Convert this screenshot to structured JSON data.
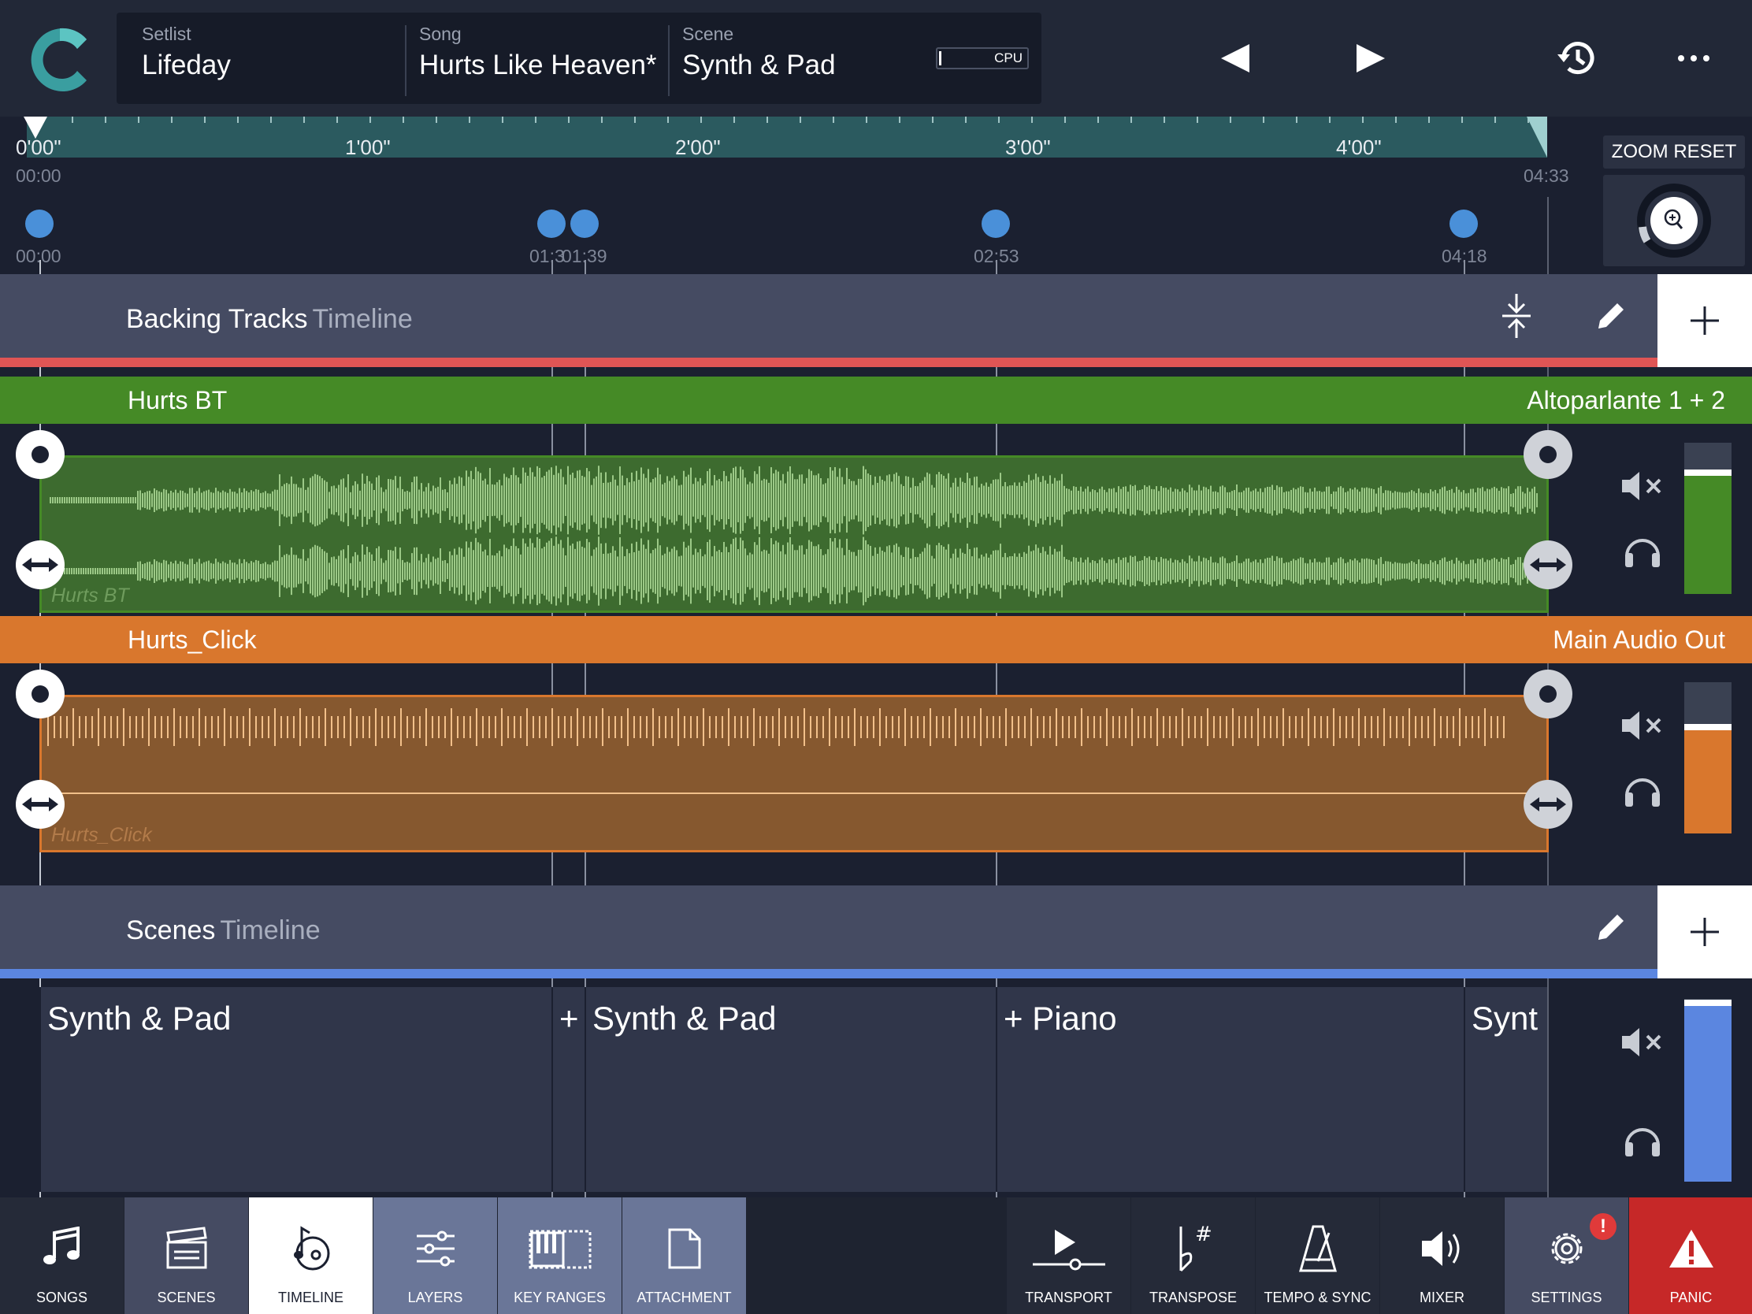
{
  "header": {
    "setlist_label": "Setlist",
    "setlist_value": "Lifeday",
    "song_label": "Song",
    "song_value": "Hurts Like Heaven*",
    "scene_label": "Scene",
    "scene_value": "Synth & Pad",
    "cpu_label": "CPU",
    "icons": [
      "app-logo",
      "previous-icon",
      "play-icon",
      "history-icon",
      "more-icon"
    ]
  },
  "ruler": {
    "time_labels": [
      "0'00\"",
      "1'00\"",
      "2'00\"",
      "3'00\"",
      "4'00\""
    ],
    "start_time": "00:00",
    "end_time": "04:33",
    "markers": [
      "00:00",
      "01:30",
      "01:39",
      "02:53",
      "04:18"
    ],
    "marker_labels": [
      "00:00",
      "01:3",
      "01:39",
      "02:53",
      "04:18"
    ],
    "zoom_reset_label": "ZOOM RESET"
  },
  "backing": {
    "title": "Backing Tracks",
    "subtitle": "Timeline",
    "accent": "#e05555",
    "tracks": [
      {
        "name": "Hurts BT",
        "output": "Altoparlante 1 + 2",
        "clip_label": "Hurts BT",
        "color": "#458a26",
        "meter_level": 0.78
      },
      {
        "name": "Hurts_Click",
        "output": "Main Audio Out",
        "clip_label": "Hurts_Click",
        "color": "#d9772d",
        "meter_level": 0.68
      }
    ]
  },
  "scenes": {
    "title": "Scenes",
    "subtitle": "Timeline",
    "accent": "#5b86e0",
    "blocks": [
      "Synth & Pad",
      "+",
      "Synth & Pad",
      "+ Piano",
      "Synt"
    ],
    "meter_level": 0.96
  },
  "bottom_nav": {
    "left": [
      "SONGS",
      "SCENES",
      "TIMELINE",
      "LAYERS",
      "KEY RANGES",
      "ATTACHMENT"
    ],
    "right": [
      "TRANSPORT",
      "TRANSPOSE",
      "TEMPO & SYNC",
      "MIXER",
      "SETTINGS",
      "PANIC"
    ],
    "active": "TIMELINE",
    "alert_badge": "!"
  }
}
